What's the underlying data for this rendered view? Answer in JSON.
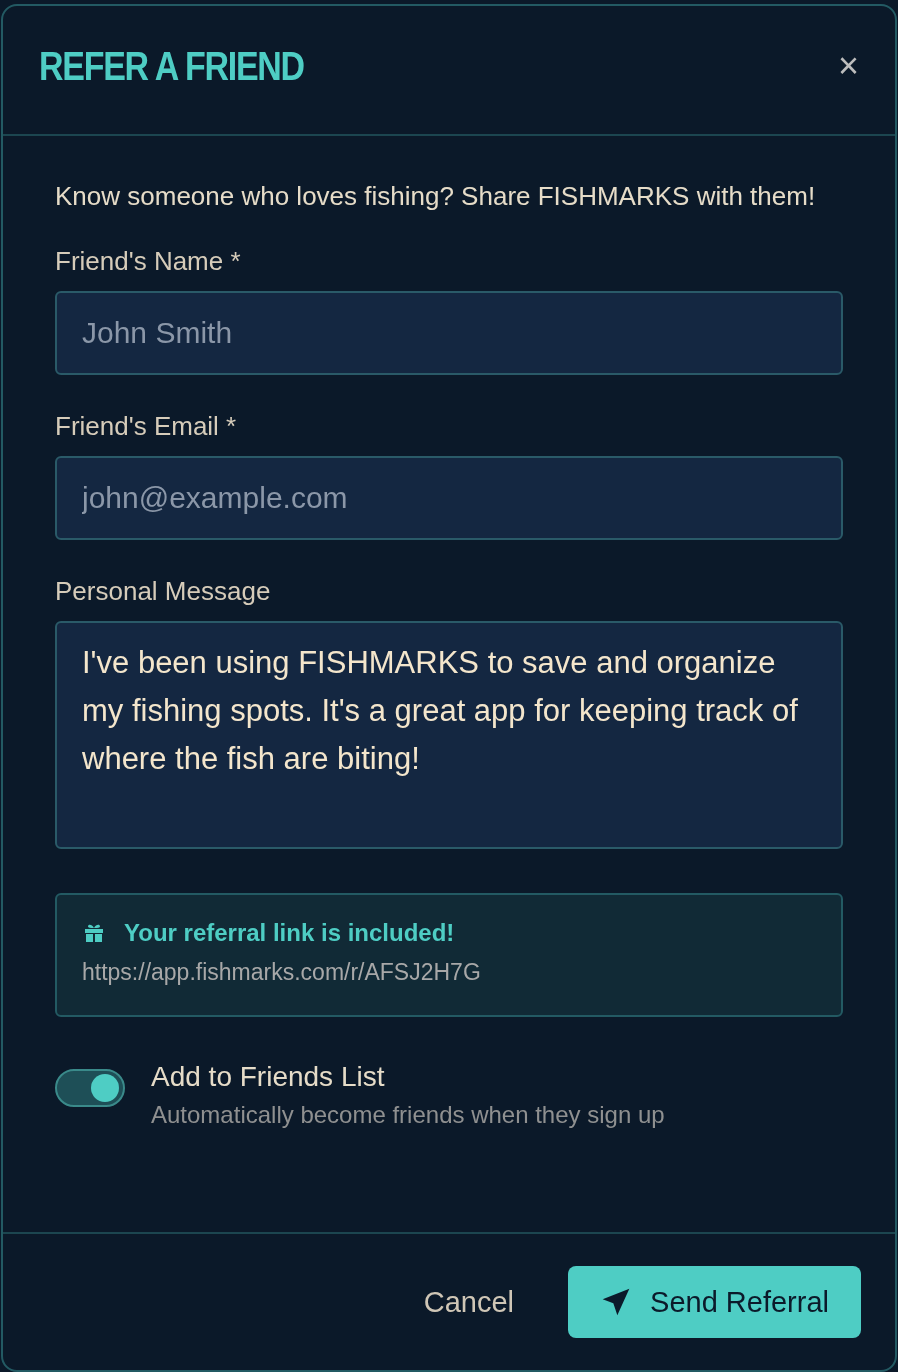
{
  "dialog": {
    "title": "REFER A FRIEND",
    "close": "×"
  },
  "intro": "Know someone who loves fishing? Share FISHMARKS with them!",
  "fields": [
    {
      "label": "Friend's Name *",
      "placeholder": "John Smith"
    },
    {
      "label": "Friend's Email *",
      "placeholder": "john@example.com"
    }
  ],
  "message": {
    "label": "Personal Message",
    "value": "I've been using FISHMARKS to save and organize my fishing spots. It's a great app for keeping track of where the fish are biting!"
  },
  "referral": {
    "heading": "Your referral link is included!",
    "link": "https://app.fishmarks.com/r/AFSJ2H7G"
  },
  "toggle": {
    "label": "Add to Friends List",
    "description": "Automatically become friends when they sign up",
    "on": true
  },
  "buttons": {
    "cancel": "Cancel",
    "send": "Send Referral"
  }
}
